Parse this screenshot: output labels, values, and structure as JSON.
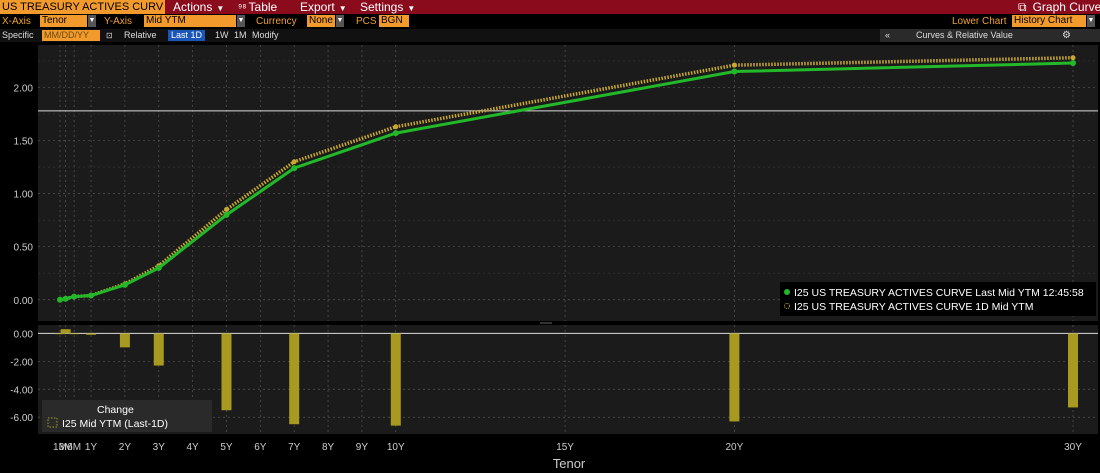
{
  "header": {
    "title": "US TREASURY ACTIVES CURV",
    "menus": [
      "Actions",
      "Table",
      "Export",
      "Settings"
    ],
    "graph_curves_label": "Graph Curves"
  },
  "options": {
    "x_axis_label": "X-Axis",
    "x_axis_value": "Tenor",
    "y_axis_label": "Y-Axis",
    "y_axis_value": "Mid YTM",
    "currency_label": "Currency",
    "currency_value": "None",
    "pcs_label": "PCS",
    "pcs_value": "BGN",
    "lower_chart_label": "Lower Chart",
    "lower_chart_value": "History Chart"
  },
  "row3": {
    "specific_label": "Specific",
    "date_placeholder": "MM/DD/YY",
    "relative_label": "Relative",
    "last_label": "Last",
    "btn_1d": "1D",
    "btn_1w": "1W",
    "btn_1m": "1M",
    "modify_label": "Modify",
    "curves_label": "Curves & Relative Value"
  },
  "chart_data": [
    {
      "type": "line",
      "x": [
        "1M",
        "3M",
        "6M",
        "1Y",
        "2Y",
        "3Y",
        "5Y",
        "7Y",
        "10Y",
        "20Y",
        "30Y"
      ],
      "series": [
        {
          "name": "I25 US TREASURY ACTIVES CURVE Last Mid YTM 12:45:58",
          "color": "#22b82a",
          "values": [
            0.0,
            0.01,
            0.03,
            0.04,
            0.14,
            0.3,
            0.8,
            1.24,
            1.57,
            2.15,
            2.23
          ]
        },
        {
          "name": "I25 US TREASURY ACTIVES CURVE 1D Mid YTM",
          "color": "#c8a830",
          "values": [
            0.0,
            0.01,
            0.03,
            0.04,
            0.15,
            0.32,
            0.85,
            1.3,
            1.63,
            2.21,
            2.28
          ]
        }
      ],
      "yticks": [
        "2.00",
        "1.50",
        "1.00",
        "0.50",
        "0.00"
      ],
      "ylim": [
        -0.2,
        2.4
      ],
      "reference_line": 1.78
    },
    {
      "type": "bar",
      "title": "Change",
      "series_label": "I25 Mid YTM (Last-1D)",
      "color": "#a89a20",
      "x": [
        "1M",
        "3M",
        "6M",
        "1Y",
        "2Y",
        "3Y",
        "5Y",
        "7Y",
        "10Y",
        "20Y",
        "30Y"
      ],
      "values": [
        0.0,
        0.3,
        0.0,
        -0.1,
        -1.0,
        -2.3,
        -5.5,
        -6.5,
        -6.6,
        -6.3,
        -5.3
      ],
      "yticks": [
        "0.00",
        "-2.00",
        "-4.00",
        "-6.00"
      ],
      "ylim": [
        -7.2,
        0.6
      ],
      "xlabel": "Tenor",
      "xticks": [
        "1M",
        "3M",
        "6M",
        "1Y",
        "2Y",
        "3Y",
        "4Y",
        "5Y",
        "6Y",
        "7Y",
        "8Y",
        "9Y",
        "10Y",
        "15Y",
        "20Y",
        "30Y"
      ]
    }
  ]
}
